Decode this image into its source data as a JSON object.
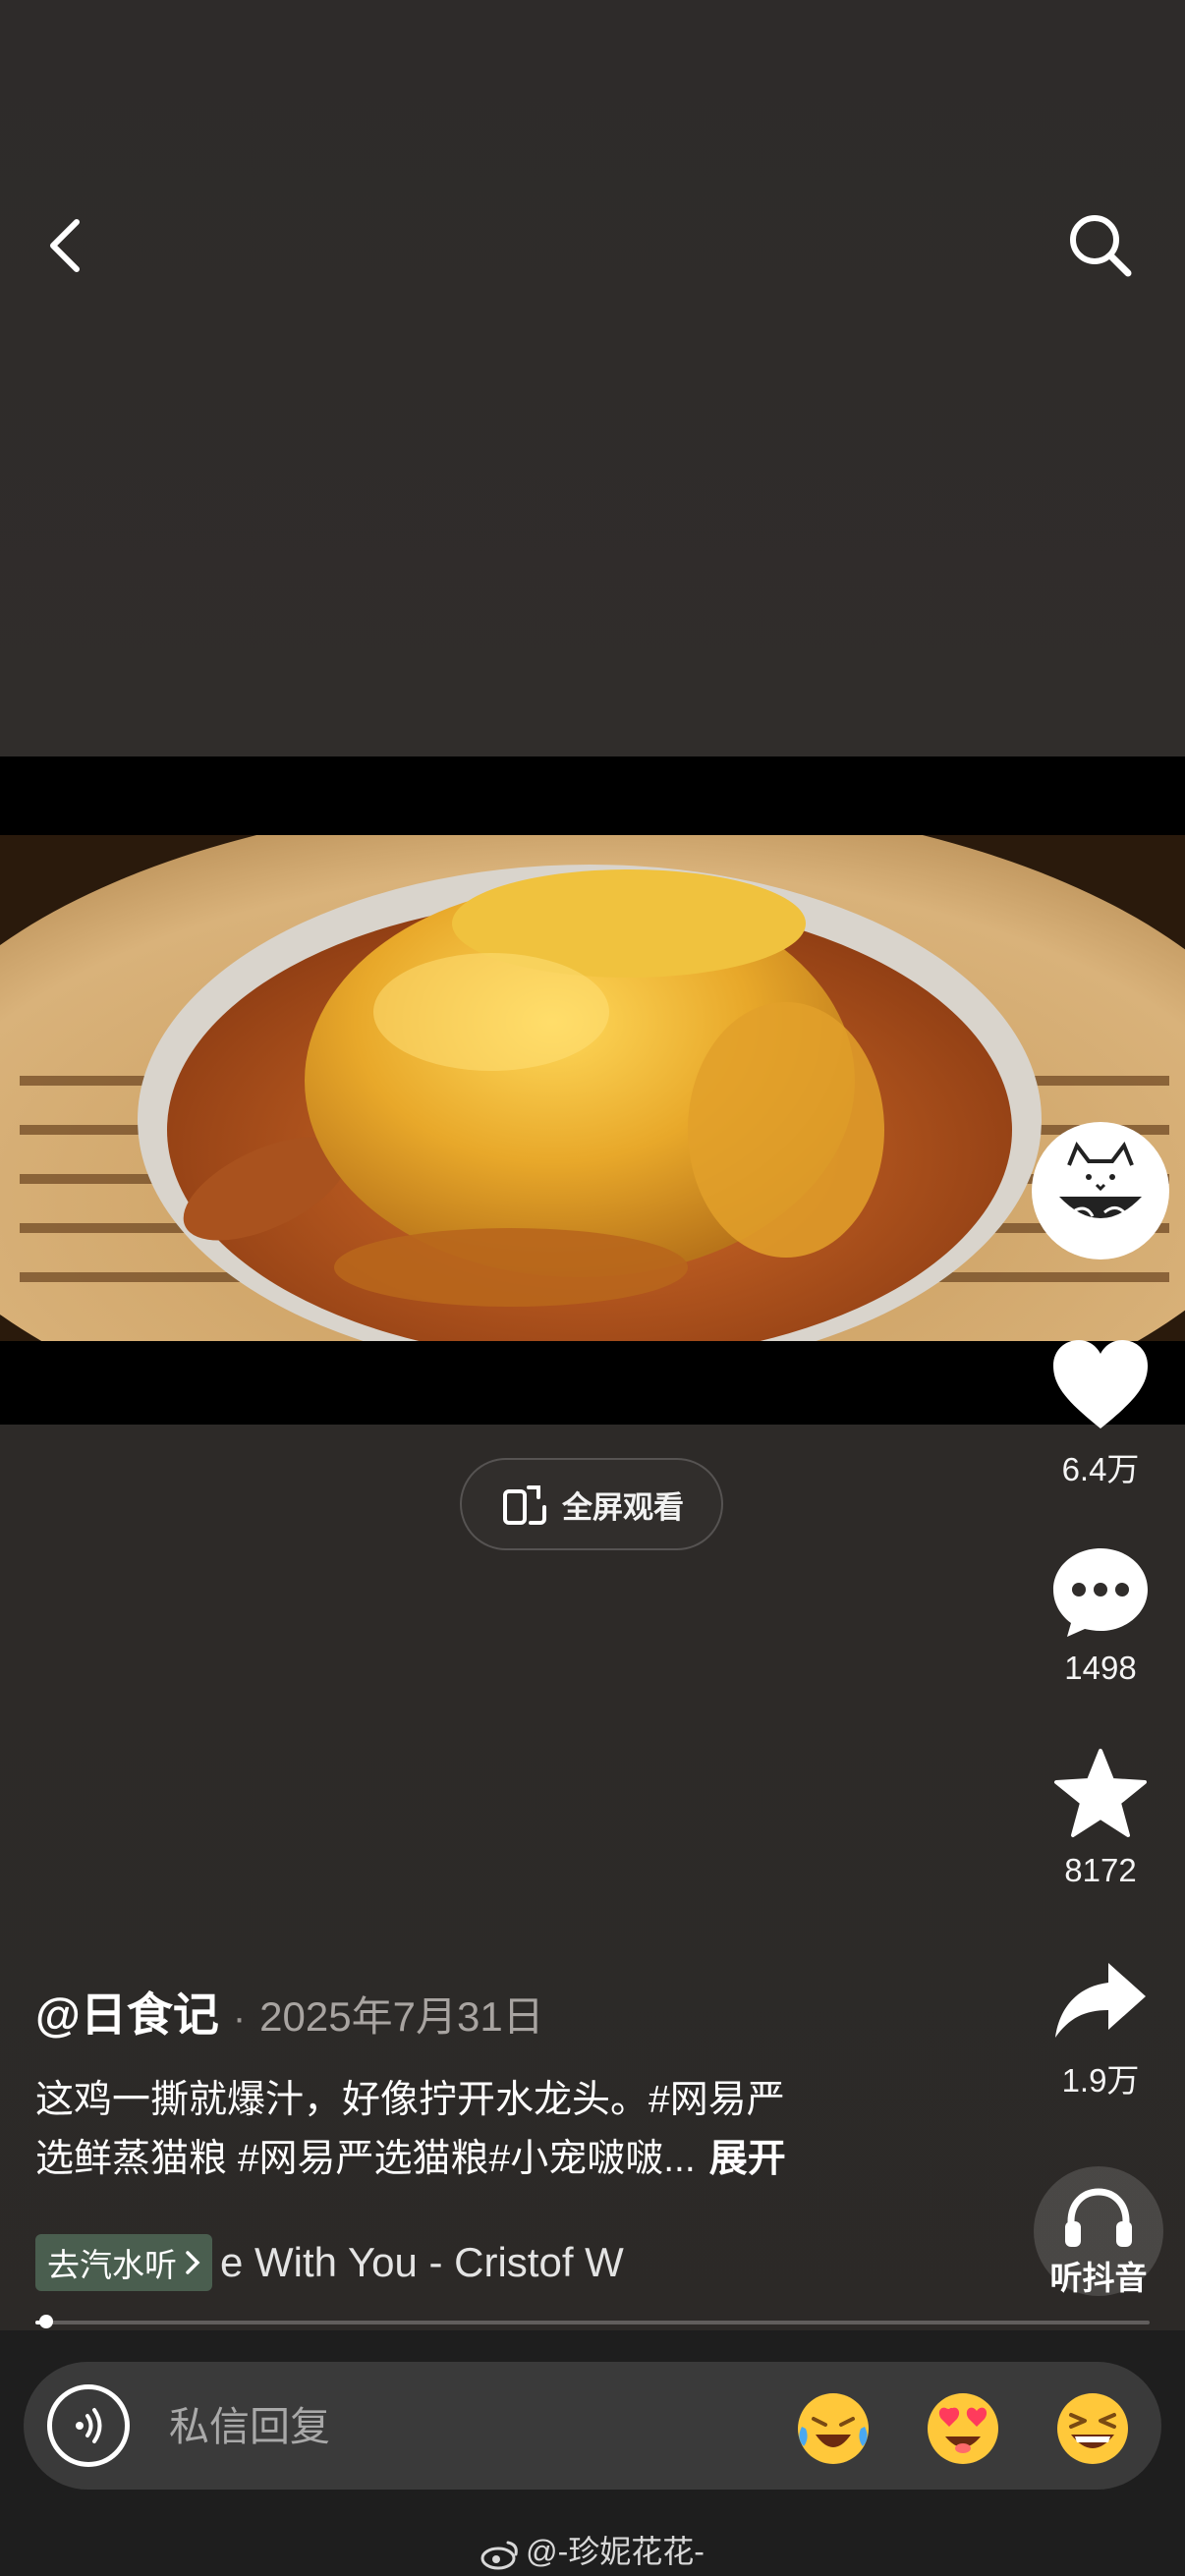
{
  "nav": {
    "back_icon": "chevron-left-icon",
    "search_icon": "search-icon"
  },
  "video": {
    "fullscreen_label": "全屏观看",
    "fullscreen_icon": "rotate-phone-icon"
  },
  "actions": {
    "like_count": "6.4万",
    "comment_count": "1498",
    "favorite_count": "8172",
    "share_count": "1.9万",
    "listen_label": "听抖音"
  },
  "post": {
    "author": "@日食记",
    "date": "2025年7月31日",
    "caption_line1": "这鸡一撕就爆汁，好像拧开水龙头。#网易严",
    "caption_line2": "选鲜蒸猫粮 #网易严选猫粮#小宠啵啵...",
    "expand_label": "展开",
    "music_chip": "去汽水听",
    "music_title": "e With You - Cristof W",
    "progress": 0.01
  },
  "reply": {
    "placeholder": "私信回复"
  },
  "emojis": [
    "laughing-crying-emoji",
    "heart-eyes-emoji",
    "grinning-squint-emoji"
  ],
  "watermark": "@-珍妮花花-",
  "colors": {
    "background": "#2f2c2a",
    "music_chip": "#4a5e4f",
    "input_box": "#3a3a3a"
  }
}
